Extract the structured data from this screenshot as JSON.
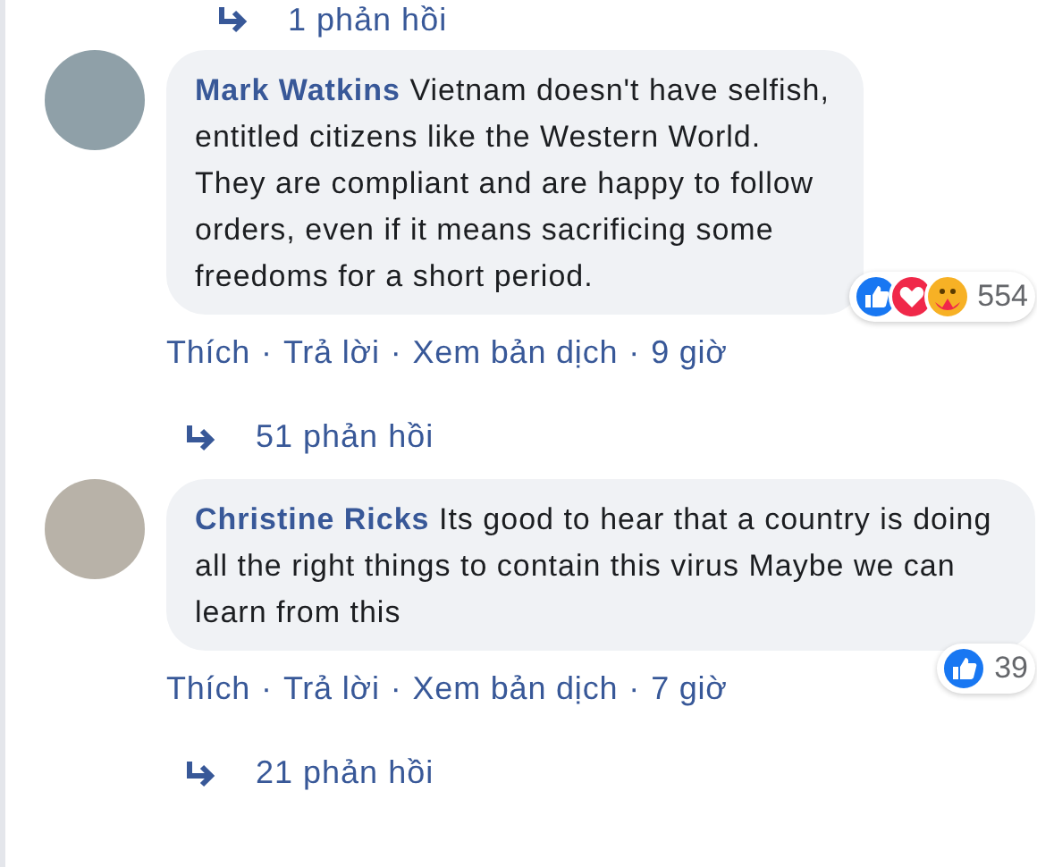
{
  "previous_replies": {
    "text": "1 phản hồi"
  },
  "comments": [
    {
      "author": "Mark Watkins",
      "text": "Vietnam doesn't have selfish, entitled citizens like the Western World. They are compliant and are happy to follow orders, even if it means sacrificing some freedoms for a short period.",
      "reactions": [
        {
          "kind": "like"
        },
        {
          "kind": "love"
        },
        {
          "kind": "care"
        }
      ],
      "reaction_count": "554",
      "actions": [
        "Thích",
        "Trả lời",
        "Xem bản dịch"
      ],
      "separator": "·",
      "time": "9 giờ",
      "replies": "51 phản hồi"
    },
    {
      "author": "Christine Ricks",
      "text": "Its good to hear that a country is doing all the right things to contain this virus Maybe we can learn from this",
      "reactions": [
        {
          "kind": "like"
        }
      ],
      "reaction_count": "39",
      "actions": [
        "Thích",
        "Trả lời",
        "Xem bản dịch"
      ],
      "separator": "·",
      "time": "7 giờ",
      "replies": "21 phản hồi"
    }
  ]
}
